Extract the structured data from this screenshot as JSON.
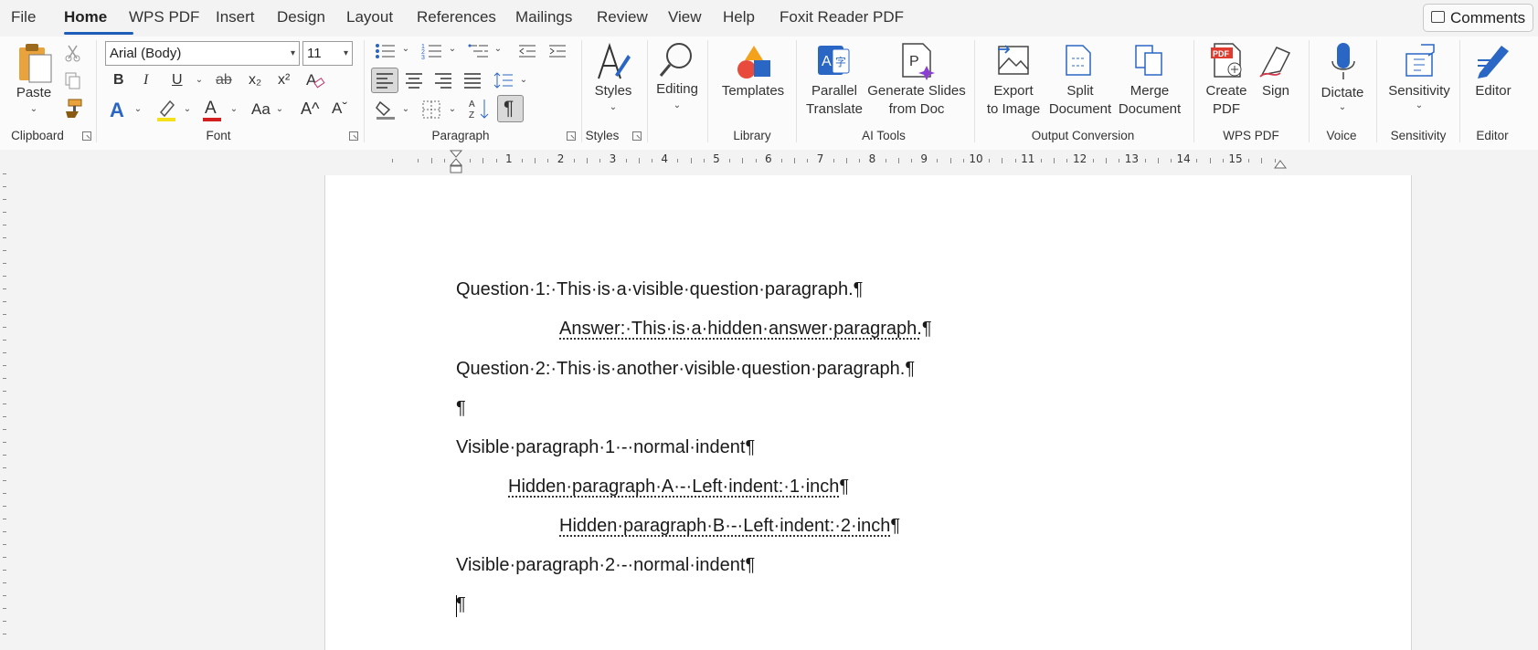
{
  "menu": {
    "file": "File",
    "home": "Home",
    "wps_pdf": "WPS PDF",
    "insert": "Insert",
    "design": "Design",
    "layout": "Layout",
    "references": "References",
    "mailings": "Mailings",
    "review": "Review",
    "view": "View",
    "help": "Help",
    "foxit": "Foxit Reader PDF",
    "comments": "Comments"
  },
  "ribbon": {
    "clipboard": {
      "paste": "Paste",
      "group": "Clipboard"
    },
    "font": {
      "font_name": "Arial (Body)",
      "font_size": "11",
      "group": "Font",
      "bold": "B",
      "italic": "I",
      "underline": "U",
      "strike": "ab",
      "subscript": "x₂",
      "superscript": "x²",
      "text_effects": "A",
      "font_color": "A",
      "change_case": "Aa",
      "grow": "A^",
      "shrink": "Aˇ"
    },
    "paragraph": {
      "group": "Paragraph",
      "pilcrow": "¶"
    },
    "styles": {
      "label": "Styles",
      "group": "Styles"
    },
    "editing": {
      "label": "Editing"
    },
    "library": {
      "templates": "Templates",
      "group": "Library"
    },
    "ai_tools": {
      "parallel": "Parallel",
      "translate": "Translate",
      "generate_slides": "Generate Slides",
      "from_doc": "from Doc",
      "group": "AI Tools"
    },
    "output": {
      "export": "Export",
      "to_image": "to Image",
      "split": "Split",
      "split_doc": "Document",
      "merge": "Merge",
      "merge_doc": "Document",
      "group": "Output Conversion"
    },
    "wps": {
      "create": "Create",
      "pdf": "PDF",
      "sign": "Sign",
      "group": "WPS PDF"
    },
    "voice": {
      "dictate": "Dictate",
      "group": "Voice"
    },
    "sensitivity": {
      "label": "Sensitivity",
      "group": "Sensitivity"
    },
    "editor": {
      "label": "Editor",
      "group": "Editor"
    }
  },
  "ruler": {
    "numbers": [
      "1",
      "2",
      "3",
      "4",
      "5",
      "6",
      "7",
      "8",
      "9",
      "10",
      "11",
      "12",
      "13",
      "14",
      "15"
    ]
  },
  "document": {
    "p1": "Question·1:·This·is·a·visible·question·paragraph.¶",
    "p2": "Answer:·This·is·a·hidden·answer·paragraph.",
    "p2_mark": "¶",
    "p3": "Question·2:·This·is·another·visible·question·paragraph.¶",
    "p4": "¶",
    "p5": "Visible·paragraph·1·-·normal·indent¶",
    "p6": "Hidden·paragraph·A·-·Left·indent:·1·inch",
    "p6_mark": "¶",
    "p7": "Hidden·paragraph·B·-·Left·indent:·2·inch",
    "p7_mark": "¶",
    "p8": "Visible·paragraph·2·-·normal·indent¶",
    "p9": "¶"
  }
}
